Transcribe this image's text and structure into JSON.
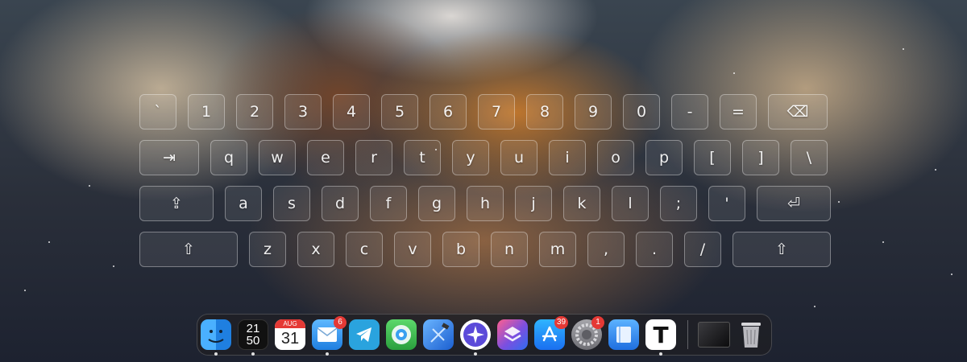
{
  "keyboard": {
    "row1": [
      {
        "id": "key-backtick",
        "label": "`"
      },
      {
        "id": "key-1",
        "label": "1"
      },
      {
        "id": "key-2",
        "label": "2"
      },
      {
        "id": "key-3",
        "label": "3"
      },
      {
        "id": "key-4",
        "label": "4"
      },
      {
        "id": "key-5",
        "label": "5"
      },
      {
        "id": "key-6",
        "label": "6"
      },
      {
        "id": "key-7",
        "label": "7"
      },
      {
        "id": "key-8",
        "label": "8"
      },
      {
        "id": "key-9",
        "label": "9"
      },
      {
        "id": "key-0",
        "label": "0"
      },
      {
        "id": "key-minus",
        "label": "-"
      },
      {
        "id": "key-equals",
        "label": "="
      },
      {
        "id": "key-backspace",
        "label": "⌫"
      }
    ],
    "row2": [
      {
        "id": "key-tab",
        "label": "⇥"
      },
      {
        "id": "key-q",
        "label": "q"
      },
      {
        "id": "key-w",
        "label": "w"
      },
      {
        "id": "key-e",
        "label": "e"
      },
      {
        "id": "key-r",
        "label": "r"
      },
      {
        "id": "key-t",
        "label": "t"
      },
      {
        "id": "key-y",
        "label": "y"
      },
      {
        "id": "key-u",
        "label": "u"
      },
      {
        "id": "key-i",
        "label": "i"
      },
      {
        "id": "key-o",
        "label": "o"
      },
      {
        "id": "key-p",
        "label": "p"
      },
      {
        "id": "key-left-bracket",
        "label": "["
      },
      {
        "id": "key-right-bracket",
        "label": "]"
      },
      {
        "id": "key-backslash",
        "label": "\\"
      }
    ],
    "row3": [
      {
        "id": "key-caps-lock",
        "label": "⇪"
      },
      {
        "id": "key-a",
        "label": "a"
      },
      {
        "id": "key-s",
        "label": "s"
      },
      {
        "id": "key-d",
        "label": "d"
      },
      {
        "id": "key-f",
        "label": "f"
      },
      {
        "id": "key-g",
        "label": "g"
      },
      {
        "id": "key-h",
        "label": "h"
      },
      {
        "id": "key-j",
        "label": "j"
      },
      {
        "id": "key-k",
        "label": "k"
      },
      {
        "id": "key-l",
        "label": "l"
      },
      {
        "id": "key-semicolon",
        "label": ";"
      },
      {
        "id": "key-quote",
        "label": "'"
      },
      {
        "id": "key-return",
        "label": "⏎"
      }
    ],
    "row4": [
      {
        "id": "key-left-shift",
        "label": "⇧"
      },
      {
        "id": "key-z",
        "label": "z"
      },
      {
        "id": "key-x",
        "label": "x"
      },
      {
        "id": "key-c",
        "label": "c"
      },
      {
        "id": "key-v",
        "label": "v"
      },
      {
        "id": "key-b",
        "label": "b"
      },
      {
        "id": "key-n",
        "label": "n"
      },
      {
        "id": "key-m",
        "label": "m"
      },
      {
        "id": "key-comma",
        "label": ","
      },
      {
        "id": "key-period",
        "label": "."
      },
      {
        "id": "key-slash",
        "label": "/"
      },
      {
        "id": "key-right-shift",
        "label": "⇧"
      }
    ]
  },
  "dock": {
    "clock": {
      "hour": "21",
      "minute": "50"
    },
    "calendar": {
      "month": "AUG",
      "day": "31"
    },
    "mail_badge": "6",
    "app_store_badge": "39",
    "settings_badge": "1",
    "text_app_glyph": "T"
  },
  "colors": {
    "finder_blue": "#3d9df3",
    "telegram_blue": "#2aa3de",
    "badge_red": "#e53935",
    "shortcuts_purple": "#7b4fe0"
  }
}
